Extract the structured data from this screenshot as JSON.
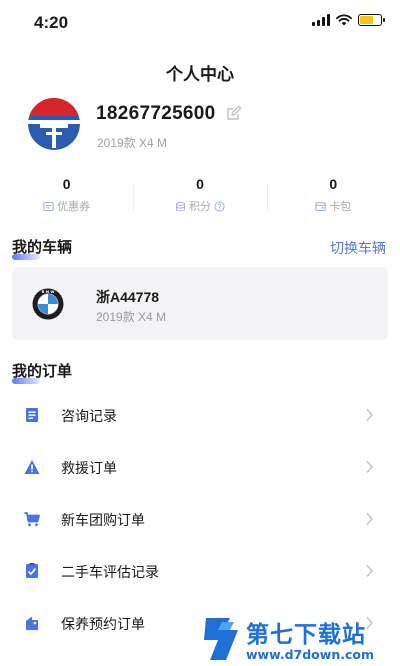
{
  "status_bar": {
    "time": "4:20"
  },
  "header": {
    "title": "个人中心"
  },
  "profile": {
    "phone": "18267725600",
    "car_model": "2019款 X4 M"
  },
  "stats": [
    {
      "value": "0",
      "label": "优惠券",
      "icon": "coupon-icon"
    },
    {
      "value": "0",
      "label": "积分",
      "icon": "points-icon"
    },
    {
      "value": "0",
      "label": "卡包",
      "icon": "card-wallet-icon"
    }
  ],
  "vehicle_section": {
    "title": "我的车辆",
    "switch_label": "切换车辆",
    "car": {
      "plate": "浙A44778",
      "model": "2019款 X4 M",
      "brand": "BMW"
    }
  },
  "order_section": {
    "title": "我的订单",
    "items": [
      {
        "label": "咨询记录",
        "icon": "document-icon"
      },
      {
        "label": "救援订单",
        "icon": "warning-icon"
      },
      {
        "label": "新车团购订单",
        "icon": "cart-icon"
      },
      {
        "label": "二手车评估记录",
        "icon": "checklist-icon"
      },
      {
        "label": "保养预约订单",
        "icon": "maintenance-icon"
      }
    ]
  },
  "watermark": {
    "brand": "第七下载站",
    "url": "www.d7down.com"
  },
  "colors": {
    "accent": "#4f7bd9",
    "icon_blue": "#4a74e0",
    "card_bg": "#f3f3f5",
    "muted": "#a0a0a0"
  }
}
